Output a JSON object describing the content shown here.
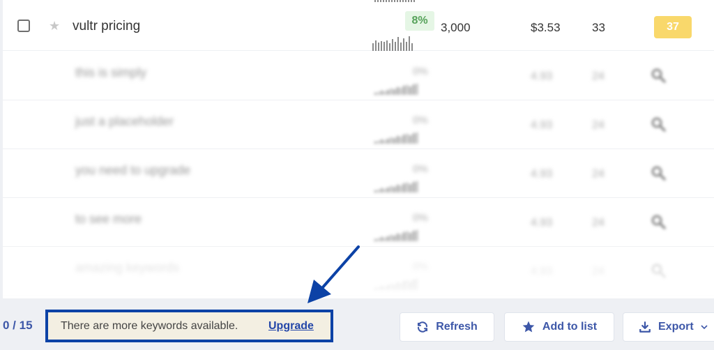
{
  "keyword_row": {
    "keyword": "vultr pricing",
    "difficulty": "8%",
    "volume": "3,000",
    "cpc": "$3.53",
    "pd": "33",
    "sd": "37",
    "trend": [
      0.5,
      0.7,
      0.55,
      0.65,
      0.6,
      0.7,
      0.5,
      0.75,
      0.6,
      0.9,
      0.55,
      0.8,
      0.6,
      0.95,
      0.5
    ]
  },
  "placeholder_rows": [
    {
      "keyword": "this is simply",
      "pct": "0%",
      "cpc": "4.93",
      "pd": "24"
    },
    {
      "keyword": "just a placeholder",
      "pct": "0%",
      "cpc": "4.93",
      "pd": "24"
    },
    {
      "keyword": "you need to upgrade",
      "pct": "0%",
      "cpc": "4.93",
      "pd": "24"
    },
    {
      "keyword": "to see more",
      "pct": "0%",
      "cpc": "4.93",
      "pd": "24"
    },
    {
      "keyword": "amazing keywords",
      "pct": "0%",
      "cpc": "4.93",
      "pd": "24"
    }
  ],
  "footer": {
    "page_count": "0 / 15",
    "notice_text": "There are more keywords available.",
    "upgrade_label": "Upgrade",
    "refresh_label": "Refresh",
    "add_to_list_label": "Add to list",
    "export_label": "Export"
  },
  "icons": {
    "star": "star-icon",
    "refresh": "refresh-icon",
    "add_to_list": "star-icon",
    "export": "download-icon",
    "export_menu": "chevron-down-icon",
    "blurred_action": "magnifier-icon"
  },
  "colors": {
    "accent": "#3d57a8",
    "highlight_border": "#0c42a6",
    "difficulty_bg": "#e5f6e5",
    "difficulty_text": "#56a25a",
    "sd_badge": "#f9d86b"
  }
}
